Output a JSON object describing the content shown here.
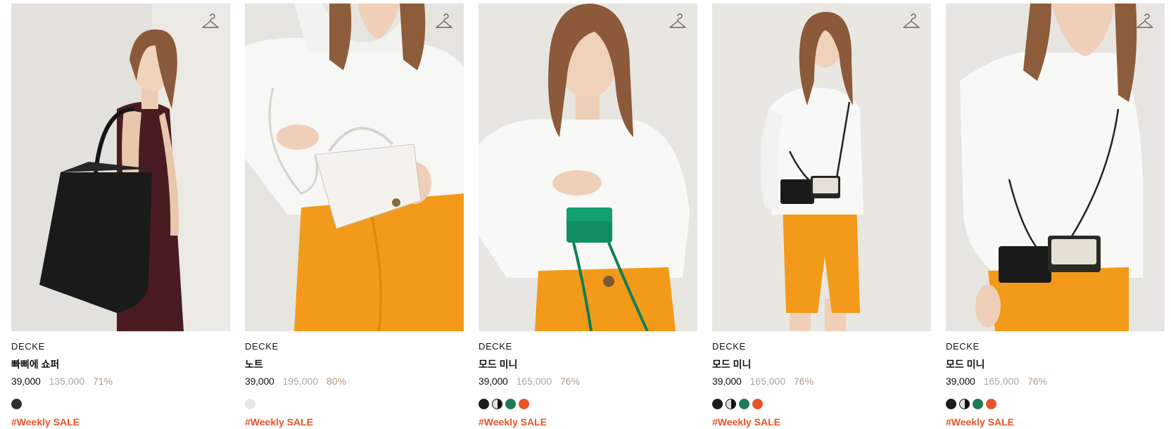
{
  "products": [
    {
      "brand": "DECKE",
      "name": "빠삐에 쇼퍼",
      "sale_price": "39,000",
      "original_price": "135,000",
      "discount": "71%",
      "tag": "#Weekly SALE",
      "swatches": [
        "#2e2e33"
      ],
      "image": "model-with-black-tote-bag"
    },
    {
      "brand": "DECKE",
      "name": "노트",
      "sale_price": "39,000",
      "original_price": "195,000",
      "discount": "80%",
      "tag": "#Weekly SALE",
      "swatches": [
        "#e6e6e6"
      ],
      "image": "model-with-white-handbag"
    },
    {
      "brand": "DECKE",
      "name": "모드 미니",
      "sale_price": "39,000",
      "original_price": "165,000",
      "discount": "76%",
      "tag": "#Weekly SALE",
      "swatches": [
        "#1c1c1c",
        "split",
        "#1f7a55",
        "#e8542a"
      ],
      "image": "model-with-green-mini-bag"
    },
    {
      "brand": "DECKE",
      "name": "모드 미니",
      "sale_price": "39,000",
      "original_price": "165,000",
      "discount": "76%",
      "tag": "#Weekly SALE",
      "swatches": [
        "#1c1c1c",
        "split",
        "#1f7a55",
        "#e8542a"
      ],
      "image": "model-with-crossbody-mini-bags"
    },
    {
      "brand": "DECKE",
      "name": "모드 미니",
      "sale_price": "39,000",
      "original_price": "165,000",
      "discount": "76%",
      "tag": "#Weekly SALE",
      "swatches": [
        "#1c1c1c",
        "split",
        "#1f7a55",
        "#e8542a"
      ],
      "image": "model-closeup-crossbody-bags"
    }
  ],
  "icons": {
    "wishlist": "hanger-icon"
  },
  "colors": {
    "tag": "#e8542a",
    "discount": "#b59a84",
    "original_price": "#a8a8a8"
  }
}
